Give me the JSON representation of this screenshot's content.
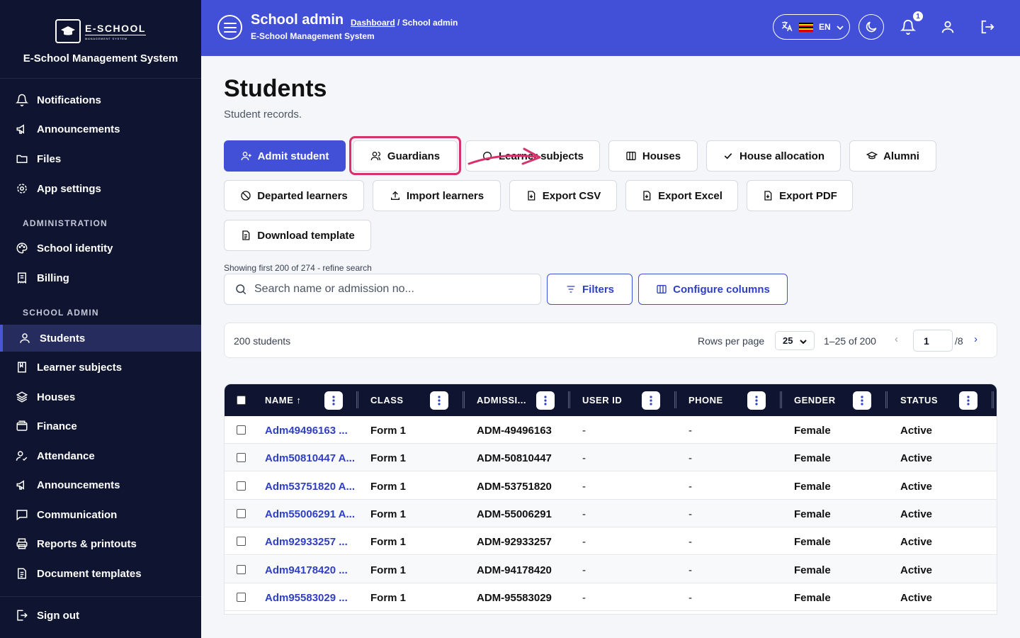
{
  "sidebar": {
    "logo_main": "E-SCHOOL",
    "logo_sub": "MANAGEMENT SYSTEM",
    "brand_name": "E-School Management System",
    "items_top": [
      {
        "label": "Notifications",
        "icon": "bell-icon"
      },
      {
        "label": "Announcements",
        "icon": "megaphone-icon"
      },
      {
        "label": "Files",
        "icon": "folder-icon"
      },
      {
        "label": "App settings",
        "icon": "gear-icon"
      }
    ],
    "section_admin": "ADMINISTRATION",
    "items_admin": [
      {
        "label": "School identity",
        "icon": "palette-icon"
      },
      {
        "label": "Billing",
        "icon": "receipt-icon"
      }
    ],
    "section_school": "SCHOOL ADMIN",
    "items_school": [
      {
        "label": "Students",
        "icon": "user-icon",
        "active": true
      },
      {
        "label": "Learner subjects",
        "icon": "book-icon"
      },
      {
        "label": "Houses",
        "icon": "layers-icon"
      },
      {
        "label": "Finance",
        "icon": "wallet-icon"
      },
      {
        "label": "Attendance",
        "icon": "user-check-icon"
      },
      {
        "label": "Announcements",
        "icon": "megaphone-icon"
      },
      {
        "label": "Communication",
        "icon": "message-icon"
      },
      {
        "label": "Reports & printouts",
        "icon": "printer-icon"
      },
      {
        "label": "Document templates",
        "icon": "document-icon"
      }
    ],
    "sign_out": "Sign out"
  },
  "header": {
    "title": "School admin",
    "breadcrumb_link": "Dashboard",
    "breadcrumb_current": " / School admin",
    "subtitle": "E-School Management System",
    "language": "EN",
    "notification_count": "1",
    "accent": "#4150d6"
  },
  "page": {
    "title": "Students",
    "subtitle": "Student records."
  },
  "actions": {
    "row1": [
      {
        "label": "Admit student",
        "icon": "user-plus-icon"
      },
      {
        "label": "Guardians",
        "icon": "users-icon"
      },
      {
        "label": "Learner subjects",
        "icon": "circle-icon"
      },
      {
        "label": "Houses",
        "icon": "columns-icon"
      },
      {
        "label": "House allocation",
        "icon": "check-icon"
      },
      {
        "label": "Alumni",
        "icon": "graduation-cap-icon"
      }
    ],
    "row2": [
      {
        "label": "Departed learners",
        "icon": "ban-icon"
      },
      {
        "label": "Import learners",
        "icon": "upload-icon"
      },
      {
        "label": "Export CSV",
        "icon": "file-icon"
      },
      {
        "label": "Export Excel",
        "icon": "file-icon"
      },
      {
        "label": "Export PDF",
        "icon": "file-icon"
      }
    ],
    "row3": [
      {
        "label": "Download template",
        "icon": "file-text-icon"
      }
    ]
  },
  "search": {
    "showing": "Showing first 200 of 274 - refine search",
    "placeholder": "Search name or admission no...",
    "filters_label": "Filters",
    "configure_label": "Configure columns"
  },
  "pagination": {
    "count": "200 students",
    "rows_label": "Rows per page",
    "rows_value": "25",
    "range": "1–25 of 200",
    "page": "1",
    "of_pages": "/8"
  },
  "table": {
    "columns": [
      "NAME ↑",
      "CLASS",
      "ADMISSI...",
      "USER ID",
      "PHONE",
      "GENDER",
      "STATUS"
    ],
    "rows": [
      [
        "Adm49496163 ...",
        "Form 1",
        "ADM-49496163",
        "-",
        "-",
        "Female",
        "Active"
      ],
      [
        "Adm50810447 A...",
        "Form 1",
        "ADM-50810447",
        "-",
        "-",
        "Female",
        "Active"
      ],
      [
        "Adm53751820 A...",
        "Form 1",
        "ADM-53751820",
        "-",
        "-",
        "Female",
        "Active"
      ],
      [
        "Adm55006291 A...",
        "Form 1",
        "ADM-55006291",
        "-",
        "-",
        "Female",
        "Active"
      ],
      [
        "Adm92933257 ...",
        "Form 1",
        "ADM-92933257",
        "-",
        "-",
        "Female",
        "Active"
      ],
      [
        "Adm94178420 ...",
        "Form 1",
        "ADM-94178420",
        "-",
        "-",
        "Female",
        "Active"
      ],
      [
        "Adm95583029 ...",
        "Form 1",
        "ADM-95583029",
        "-",
        "-",
        "Female",
        "Active"
      ]
    ]
  }
}
